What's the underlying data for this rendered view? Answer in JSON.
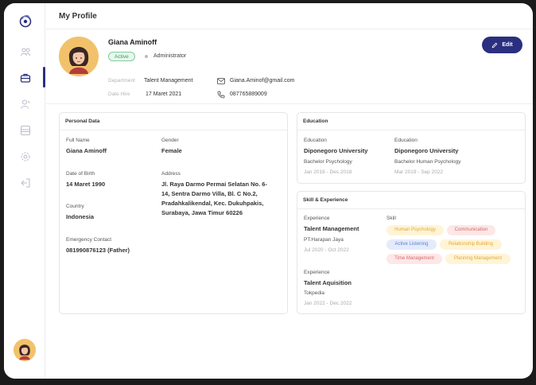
{
  "page": {
    "title": "My Profile"
  },
  "profile": {
    "name": "Giana Aminoff",
    "status": "Active",
    "role": "Administrator",
    "edit_label": "Edit",
    "department_label": "Department",
    "department": "Talent Management",
    "date_hire_label": "Date Hire",
    "date_hire": "17 Maret 2021",
    "email": "Giana.Aminof@gmail.com",
    "phone": "087765889009"
  },
  "personal": {
    "title": "Personal Data",
    "full_name_label": "Full Name",
    "full_name": "Giana Aminoff",
    "gender_label": "Gender",
    "gender": "Female",
    "dob_label": "Date of Birth",
    "dob": "14 Maret 1990",
    "address_label": "Address",
    "address": "Jl. Raya Darmo Permai Selatan No. 6-14, Sentra Darmo Villa, Bl. C No.2, Pradahkalikendal, Kec. Dukuhpakis, Surabaya, Jawa Timur 60226",
    "country_label": "Country",
    "country": "Indonesia",
    "emergency_label": "Emergency Contact",
    "emergency": "081990876123 (Father)"
  },
  "education": {
    "title": "Education",
    "items": [
      {
        "label": "Education",
        "school": "Diponegoro University",
        "degree": "Bachelor Psychology",
        "period": "Jan 2016 - Des 2018"
      },
      {
        "label": "Education",
        "school": "Diponegoro University",
        "degree": "Bachelor Human Psychology",
        "period": "Mar 2019 - Sep 2022"
      }
    ]
  },
  "skills": {
    "title": "Skill & Experience",
    "experience_label": "Experience",
    "skill_label": "Skill",
    "experience": [
      {
        "label": "Experience",
        "role": "Talent Management",
        "company": "PT.Harapan Jaya",
        "period": "Jul 2020 - Oct 2022"
      },
      {
        "label": "Experience",
        "role": "Talent Aquisition",
        "company": "Tokpedia",
        "period": "Jan 2022 - Dec 2022"
      }
    ],
    "chips": [
      "Human Psychology",
      "Communication",
      "Active Listening",
      "Relationship Building",
      "Time Management",
      "Planning Management"
    ]
  },
  "colors": {
    "brand": "#2b2f7f",
    "active": "#3a9b5c"
  },
  "icons": [
    "logo-icon",
    "people-icon",
    "briefcase-icon",
    "user-icon",
    "layout-icon",
    "settings-icon",
    "logout-icon",
    "mail-icon",
    "phone-icon",
    "pencil-icon"
  ]
}
